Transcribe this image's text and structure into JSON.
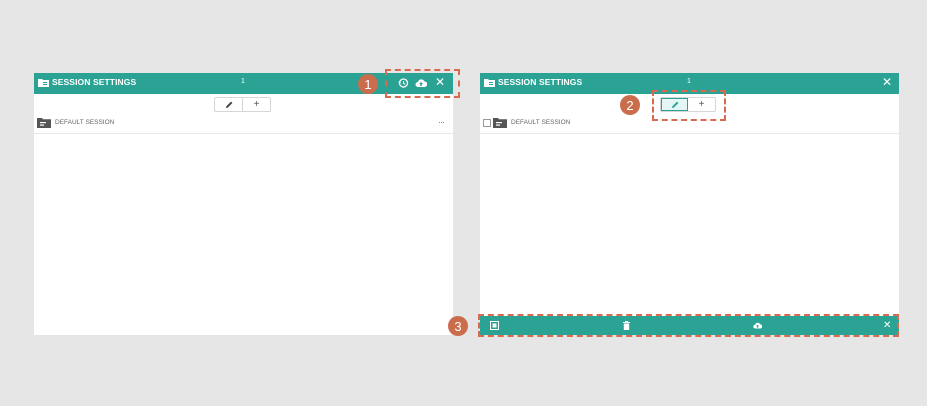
{
  "left_panel": {
    "title": "SESSION SETTINGS",
    "count": "1",
    "toolbar_icons": [
      "history-icon",
      "cloud-upload-icon",
      "close-icon"
    ],
    "close_glyph": "✕",
    "segment": {
      "edit_icon": "pencil-icon",
      "add_label": "+"
    },
    "row": {
      "label": "DEFAULT SESSION",
      "menu": "···"
    }
  },
  "right_panel": {
    "title": "SESSION SETTINGS",
    "count": "1",
    "close_glyph": "✕",
    "segment": {
      "edit_icon": "pencil-icon",
      "add_label": "+",
      "active": "edit"
    },
    "row": {
      "label": "DEFAULT SESSION"
    },
    "bottom_bar": {
      "icons": [
        "select-all-icon",
        "trash-icon",
        "cloud-upload-icon",
        "close-icon"
      ],
      "close_glyph": "✕"
    }
  },
  "callouts": [
    {
      "number": "1",
      "target": "left toolbar icons"
    },
    {
      "number": "2",
      "target": "edit/add segmented control"
    },
    {
      "number": "3",
      "target": "bottom action bar"
    }
  ],
  "colors": {
    "accent": "#2aa395",
    "callout": "#c96d4d",
    "background": "#e6e6e6"
  }
}
